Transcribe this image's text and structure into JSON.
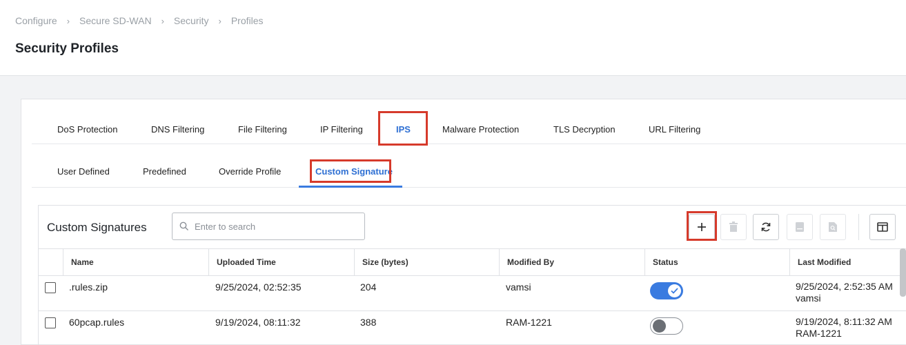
{
  "breadcrumb": [
    "Configure",
    "Secure SD-WAN",
    "Security",
    "Profiles"
  ],
  "page_title": "Security Profiles",
  "main_tabs": [
    {
      "label": "DoS Protection"
    },
    {
      "label": "DNS Filtering"
    },
    {
      "label": "File Filtering"
    },
    {
      "label": "IP Filtering"
    },
    {
      "label": "IPS",
      "active": true
    },
    {
      "label": "Malware Protection"
    },
    {
      "label": "TLS Decryption"
    },
    {
      "label": "URL Filtering"
    }
  ],
  "sub_tabs": [
    {
      "label": "User Defined"
    },
    {
      "label": "Predefined"
    },
    {
      "label": "Override Profile"
    },
    {
      "label": "Custom Signature",
      "active": true
    }
  ],
  "grid": {
    "title": "Custom Signatures",
    "search_placeholder": "Enter to search",
    "toolbar_icons": [
      "add-icon",
      "trash-icon",
      "refresh-icon",
      "document-icon",
      "document-search-icon",
      "columns-icon"
    ],
    "columns": [
      "Name",
      "Uploaded Time",
      "Size (bytes)",
      "Modified By",
      "Status",
      "Last Modified"
    ],
    "rows": [
      {
        "name": ".rules.zip",
        "uploaded": "9/25/2024, 02:52:35",
        "size": "204",
        "modified_by": "vamsi",
        "status": "on",
        "last_modified_time": "9/25/2024, 2:52:35 AM",
        "last_modified_user": "vamsi"
      },
      {
        "name": "60pcap.rules",
        "uploaded": "9/19/2024, 08:11:32",
        "size": "388",
        "modified_by": "RAM-1221",
        "status": "off",
        "last_modified_time": "9/19/2024, 8:11:32 AM",
        "last_modified_user": "RAM-1221"
      }
    ]
  },
  "colors": {
    "accent": "#3a7be0",
    "highlight": "#d63a2b",
    "active_tab_text": "#2d6fd3"
  }
}
